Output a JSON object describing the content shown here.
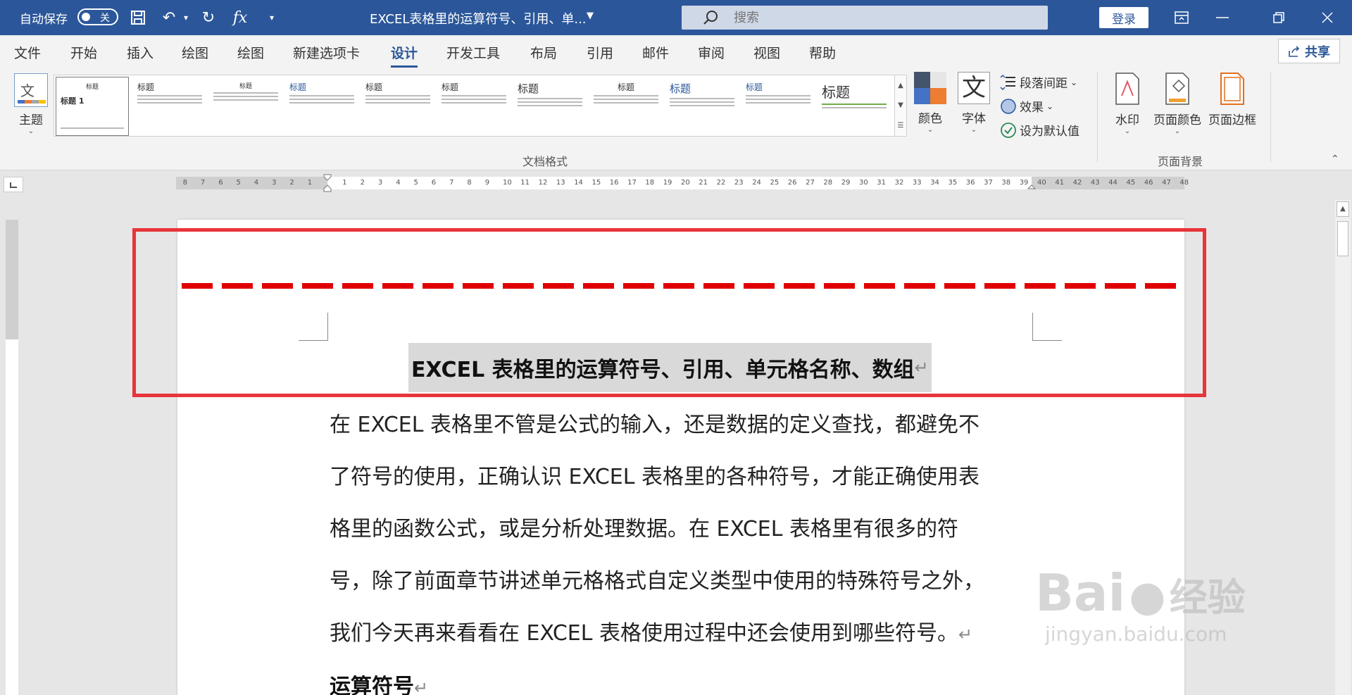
{
  "titlebar": {
    "autosave_label": "自动保存",
    "autosave_state": "关",
    "document_title": "EXCEL表格里的运算符号、引用、单...",
    "search_placeholder": "搜索",
    "login_label": "登录"
  },
  "menu": {
    "tabs": [
      "文件",
      "开始",
      "插入",
      "绘图",
      "绘图",
      "新建选项卡",
      "设计",
      "开发工具",
      "布局",
      "引用",
      "邮件",
      "审阅",
      "视图",
      "帮助"
    ],
    "active_tab": "设计",
    "share_label": "共享"
  },
  "ribbon": {
    "theme_label": "主题",
    "style_titles": [
      "标题",
      "标题",
      "标题",
      "标题",
      "标题",
      "标题",
      "标题",
      "标题",
      "标题",
      "标题",
      "标题"
    ],
    "first_card_heading": "标题 1",
    "document_format_group": "文档格式",
    "colors_label": "颜色",
    "fonts_label": "字体",
    "theme_font_glyph": "文",
    "paragraph_spacing_label": "段落间距",
    "effects_label": "效果",
    "set_default_label": "设为默认值",
    "watermark_label": "水印",
    "page_color_label": "页面颜色",
    "page_border_label": "页面边框",
    "page_background_group": "页面背景"
  },
  "ruler": {
    "left_numbers": [
      "8",
      "7",
      "6",
      "5",
      "4",
      "3",
      "2",
      "1"
    ],
    "right_numbers": [
      "1",
      "2",
      "3",
      "4",
      "5",
      "6",
      "7",
      "8",
      "9",
      "10",
      "11",
      "12",
      "13",
      "14",
      "15",
      "16",
      "17",
      "18",
      "19",
      "20",
      "21",
      "22",
      "23",
      "24",
      "25",
      "26",
      "27",
      "28",
      "29",
      "30",
      "31",
      "32",
      "33",
      "34",
      "35",
      "36",
      "37",
      "38",
      "39",
      "40",
      "41",
      "42",
      "43",
      "44",
      "45",
      "46",
      "47",
      "48"
    ]
  },
  "document": {
    "heading": "EXCEL 表格里的运算符号、引用、单元格名称、数组",
    "paragraph_lines": [
      "在 EXCEL 表格里不管是公式的输入，还是数据的定义查找，都避免不",
      "了符号的使用，正确认识 EXCEL 表格里的各种符号，才能正确使用表",
      "格里的函数公式，或是分析处理数据。在  EXCEL  表格里有很多的符",
      "号，除了前面章节讲述单元格格式自定义类型中使用的特殊符号之外，",
      "我们今天再来看看在 EXCEL 表格使用过程中还会使用到哪些符号。"
    ],
    "subheading": "运算符号",
    "return_mark": "↵"
  },
  "watermark": {
    "brand": "Bai",
    "brand_suffix": "经验",
    "url": "jingyan.baidu.com"
  },
  "colors": {
    "titlebar": "#2b579a",
    "highlight_border": "#e8343b",
    "dash_line": "#e00000"
  }
}
